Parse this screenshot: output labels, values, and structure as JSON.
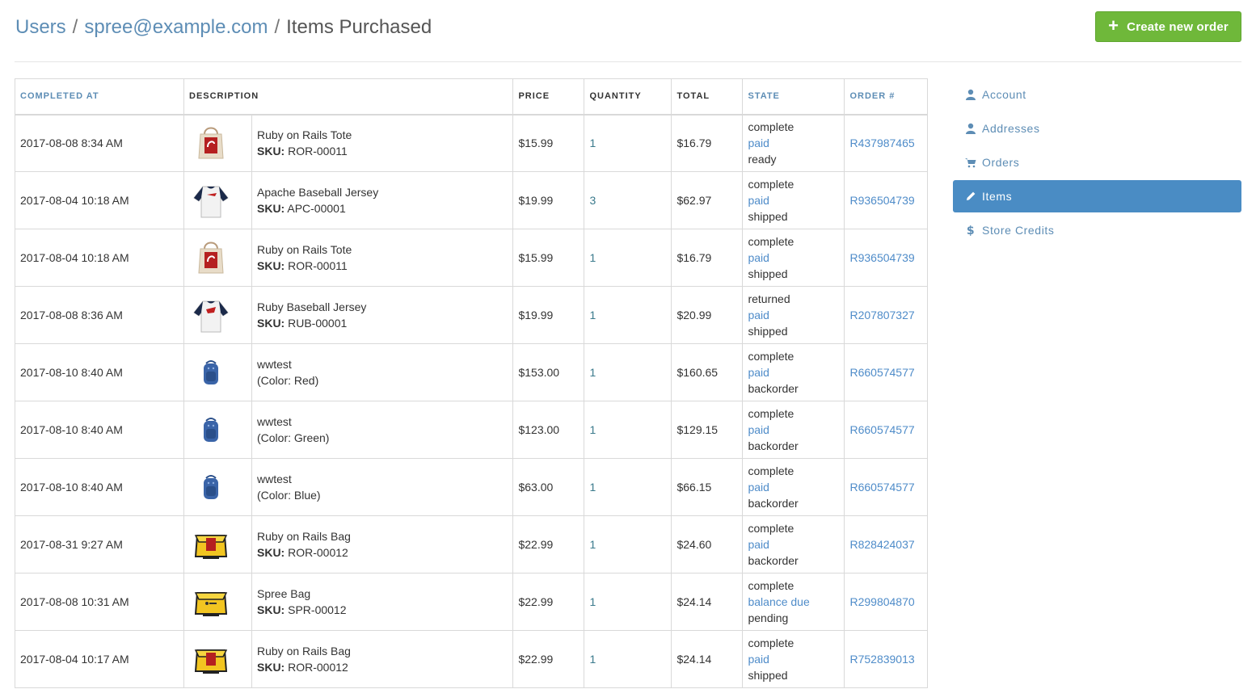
{
  "breadcrumb": {
    "users": "Users",
    "sep1": "/",
    "email": "spree@example.com",
    "sep2": "/",
    "current": "Items Purchased"
  },
  "actions": {
    "create_order": "Create new order"
  },
  "table": {
    "headers": {
      "completed_at": "Completed At",
      "description": "Description",
      "price": "Price",
      "quantity": "Quantity",
      "total": "Total",
      "state": "State",
      "order": "Order #"
    },
    "rows": [
      {
        "completed": "2017-08-08 8:34 AM",
        "thumb": "tote",
        "name": "Ruby on Rails Tote",
        "sku_label": "SKU:",
        "detail": "ROR-00011",
        "price": "$15.99",
        "qty": "1",
        "total": "$16.79",
        "state": "complete",
        "payment": "paid",
        "shipment": "ready",
        "order": "R437987465"
      },
      {
        "completed": "2017-08-04 10:18 AM",
        "thumb": "jersey-apache",
        "name": "Apache Baseball Jersey",
        "sku_label": "SKU:",
        "detail": "APC-00001",
        "price": "$19.99",
        "qty": "3",
        "total": "$62.97",
        "state": "complete",
        "payment": "paid",
        "shipment": "shipped",
        "order": "R936504739"
      },
      {
        "completed": "2017-08-04 10:18 AM",
        "thumb": "tote",
        "name": "Ruby on Rails Tote",
        "sku_label": "SKU:",
        "detail": "ROR-00011",
        "price": "$15.99",
        "qty": "1",
        "total": "$16.79",
        "state": "complete",
        "payment": "paid",
        "shipment": "shipped",
        "order": "R936504739"
      },
      {
        "completed": "2017-08-08 8:36 AM",
        "thumb": "jersey-ruby",
        "name": "Ruby Baseball Jersey",
        "sku_label": "SKU:",
        "detail": "RUB-00001",
        "price": "$19.99",
        "qty": "1",
        "total": "$20.99",
        "state": "returned",
        "payment": "paid",
        "shipment": "shipped",
        "order": "R207807327"
      },
      {
        "completed": "2017-08-10 8:40 AM",
        "thumb": "backpack",
        "name": "wwtest",
        "sku_label": "",
        "detail": "(Color: Red)",
        "price": "$153.00",
        "qty": "1",
        "total": "$160.65",
        "state": "complete",
        "payment": "paid",
        "shipment": "backorder",
        "order": "R660574577"
      },
      {
        "completed": "2017-08-10 8:40 AM",
        "thumb": "backpack",
        "name": "wwtest",
        "sku_label": "",
        "detail": "(Color: Green)",
        "price": "$123.00",
        "qty": "1",
        "total": "$129.15",
        "state": "complete",
        "payment": "paid",
        "shipment": "backorder",
        "order": "R660574577"
      },
      {
        "completed": "2017-08-10 8:40 AM",
        "thumb": "backpack",
        "name": "wwtest",
        "sku_label": "",
        "detail": "(Color: Blue)",
        "price": "$63.00",
        "qty": "1",
        "total": "$66.15",
        "state": "complete",
        "payment": "paid",
        "shipment": "backorder",
        "order": "R660574577"
      },
      {
        "completed": "2017-08-31 9:27 AM",
        "thumb": "bag-rails",
        "name": "Ruby on Rails Bag",
        "sku_label": "SKU:",
        "detail": "ROR-00012",
        "price": "$22.99",
        "qty": "1",
        "total": "$24.60",
        "state": "complete",
        "payment": "paid",
        "shipment": "backorder",
        "order": "R828424037"
      },
      {
        "completed": "2017-08-08 10:31 AM",
        "thumb": "bag-spree",
        "name": "Spree Bag",
        "sku_label": "SKU:",
        "detail": "SPR-00012",
        "price": "$22.99",
        "qty": "1",
        "total": "$24.14",
        "state": "complete",
        "payment": "balance due",
        "shipment": "pending",
        "order": "R299804870"
      },
      {
        "completed": "2017-08-04 10:17 AM",
        "thumb": "bag-rails",
        "name": "Ruby on Rails Bag",
        "sku_label": "SKU:",
        "detail": "ROR-00012",
        "price": "$22.99",
        "qty": "1",
        "total": "$24.14",
        "state": "complete",
        "payment": "paid",
        "shipment": "shipped",
        "order": "R752839013"
      }
    ]
  },
  "sidebar": {
    "items": [
      {
        "label": "Account",
        "icon": "user-icon",
        "active": false
      },
      {
        "label": "Addresses",
        "icon": "user-icon",
        "active": false
      },
      {
        "label": "Orders",
        "icon": "cart-icon",
        "active": false
      },
      {
        "label": "Items",
        "icon": "pencil-icon",
        "active": true
      },
      {
        "label": "Store Credits",
        "icon": "dollar-icon",
        "active": false
      }
    ]
  },
  "colors": {
    "link": "#4f8cc9",
    "accent": "#5d8db5",
    "active_bg": "#4a8cc4",
    "create_button": "#6fb83a"
  }
}
